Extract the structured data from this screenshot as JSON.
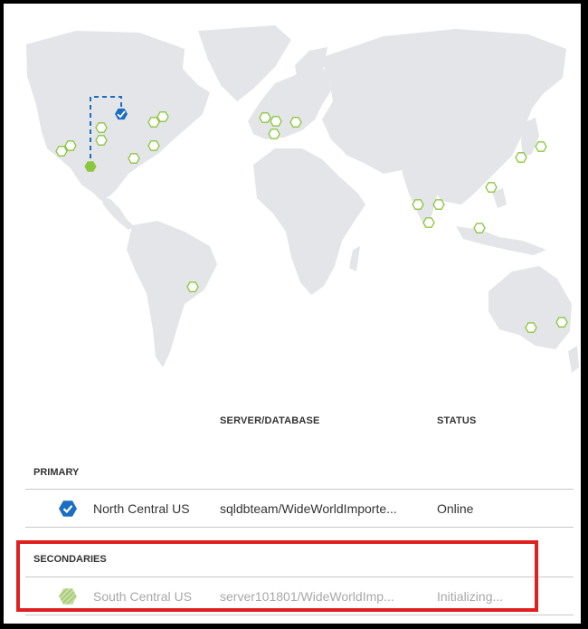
{
  "table": {
    "headers": {
      "server_database": "SERVER/DATABASE",
      "status": "STATUS"
    },
    "primary": {
      "section_label": "PRIMARY",
      "region": "North Central US",
      "server_database": "sqldbteam/WideWorldImporte...",
      "status": "Online",
      "icon": "check-hexagon-icon"
    },
    "secondaries": {
      "section_label": "SECONDARIES",
      "region": "South Central US",
      "server_database": "server101801/WideWorldImp...",
      "status": "Initializing...",
      "icon": "striped-hexagon-icon"
    }
  },
  "colors": {
    "land": "#e3e5e8",
    "region_marker": "#8cc63f",
    "primary_marker": "#1c6ec2",
    "link_line": "#1c6ec2",
    "highlight_border": "#e02020"
  }
}
